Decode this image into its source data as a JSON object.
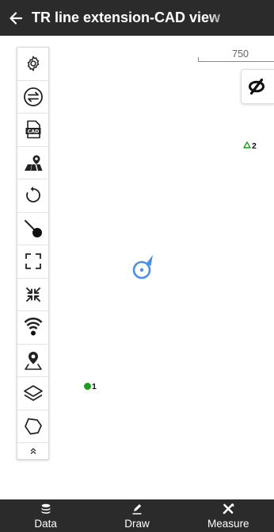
{
  "header": {
    "title": "TR line extension-CAD view",
    "back_icon": "arrow-left-icon"
  },
  "toolbar": {
    "items": [
      {
        "name": "settings",
        "icon": "gear-icon"
      },
      {
        "name": "swap",
        "icon": "swap-arrows-icon"
      },
      {
        "name": "cad-file",
        "icon": "cad-file-icon"
      },
      {
        "name": "map-location",
        "icon": "map-pin-icon"
      },
      {
        "name": "refresh",
        "icon": "rotate-icon"
      },
      {
        "name": "trace-point",
        "icon": "point-trace-icon"
      },
      {
        "name": "fullscreen",
        "icon": "expand-corners-icon"
      },
      {
        "name": "shrink",
        "icon": "compress-arrows-icon"
      },
      {
        "name": "signal",
        "icon": "signal-cone-icon"
      },
      {
        "name": "place-marker",
        "icon": "location-pin-icon"
      },
      {
        "name": "layers",
        "icon": "layers-icon"
      },
      {
        "name": "polygon",
        "icon": "polygon-icon"
      }
    ],
    "collapse_icon": "double-chevron-up-icon"
  },
  "map": {
    "scale_label": "750",
    "visibility_icon": "eye-slash-icon",
    "points": [
      {
        "label": "1",
        "color": "#1e9e1e",
        "shape": "circle"
      },
      {
        "label": "2",
        "color": "#1e9e1e",
        "shape": "triangle"
      }
    ],
    "location_color": "#4a8fe8"
  },
  "bottom_nav": [
    {
      "label": "Data",
      "icon": "database-icon"
    },
    {
      "label": "Draw",
      "icon": "draw-pen-icon"
    },
    {
      "label": "Measure",
      "icon": "measure-tools-icon"
    }
  ]
}
